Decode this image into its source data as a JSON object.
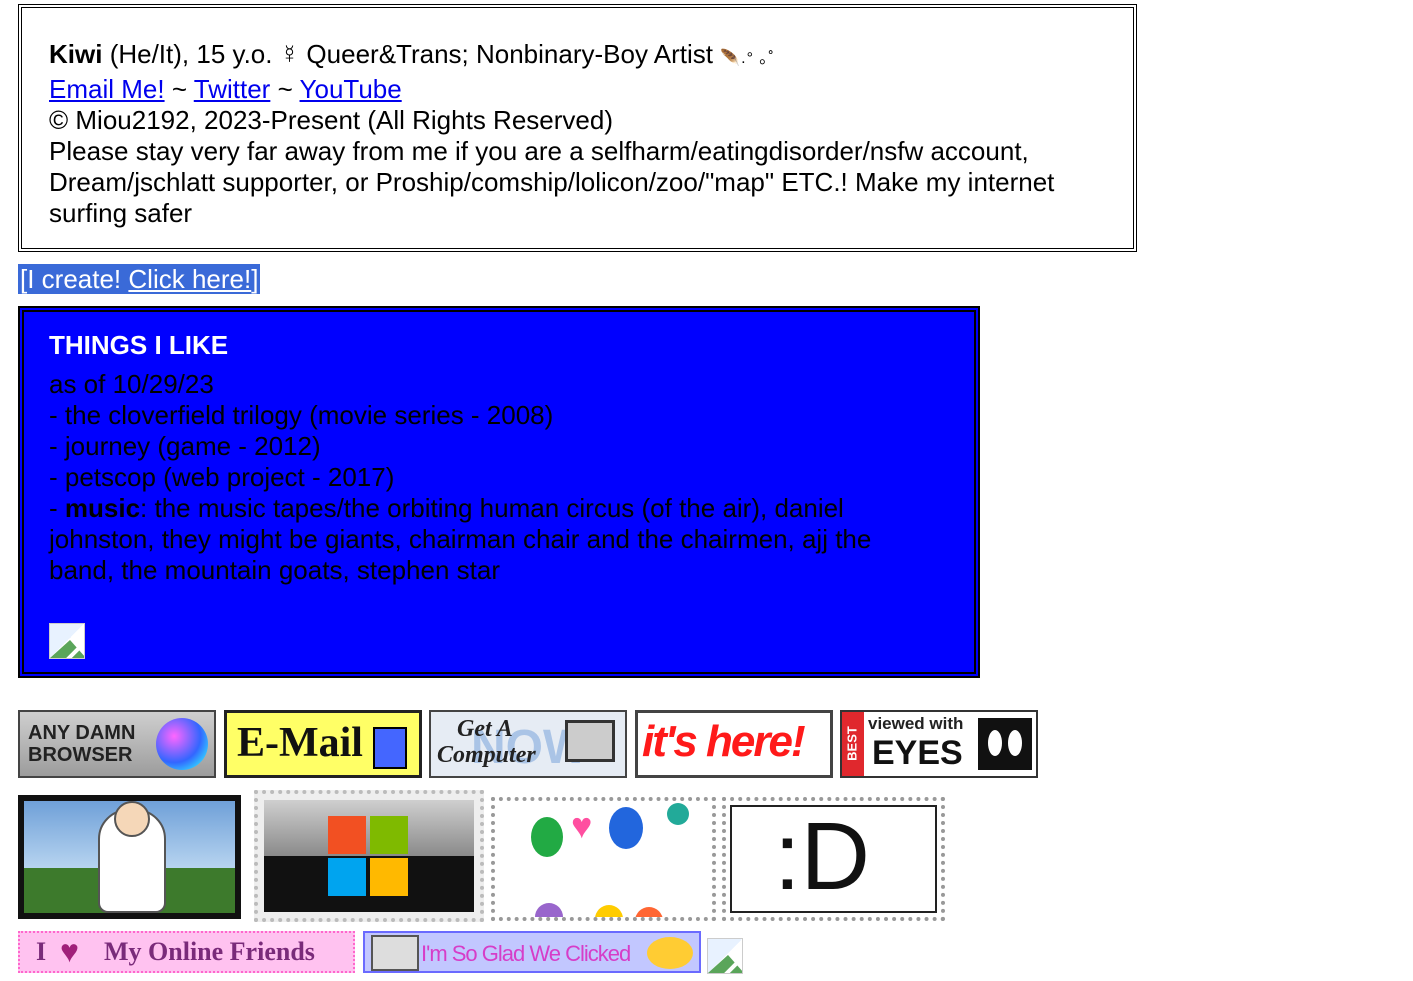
{
  "profile": {
    "name": "Kiwi",
    "pronouns_age": "(He/It), 15 y.o. ☿ Queer&Trans; Nonbinary-Boy Artist",
    "sparkle": "🪶.° ｡˚",
    "links": {
      "email": "Email Me!",
      "sep1": "~",
      "twitter": "Twitter",
      "sep2": "~",
      "youtube": "YouTube"
    },
    "copyright": "© Miou2192, 2023-Present (All Rights Reserved)",
    "warning": "Please stay very far away from me if you are a selfharm/eatingdisorder/nsfw account, Dream/jschlatt supporter, or Proship/comship/lolicon/zoo/\"map\" ETC.! Make my internet surfing safer"
  },
  "create_link": {
    "prefix": "[I create! ",
    "link": "Click here!",
    "suffix": "]"
  },
  "likes": {
    "title": "THINGS I LIKE",
    "as_of": "as of 10/29/23",
    "items": [
      "- the cloverfield trilogy (movie series - 2008)",
      "- journey (game - 2012)",
      "- petscop (web project - 2017)"
    ],
    "music_prefix": "- ",
    "music_label": "music",
    "music_list": ": the music tapes/the orbiting human circus (of the air), daniel johnston, they might be giants, chairman chair and the chairmen, ajj the band, the mountain goats, stephen star"
  },
  "buttons": [
    {
      "line1": "ANY DAMN",
      "line2": "BROWSER"
    },
    {
      "text": "E-Mail"
    },
    {
      "line1": "Get A",
      "line2": "Computer",
      "bg_word": "NOW"
    },
    {
      "text": "it's here!"
    },
    {
      "side": "BEST",
      "top": "viewed with",
      "main": "EYES"
    }
  ],
  "stamps": [
    {
      "alt": "cartoon man stamp"
    },
    {
      "alt": "windows logo stamp"
    },
    {
      "alt": "balloons stamp"
    },
    {
      "text": ":D"
    }
  ],
  "blinkies": [
    {
      "prefix": "I",
      "text": "My Online Friends"
    },
    {
      "text": "I'm So Glad We Clicked"
    }
  ],
  "colors": {
    "likes_bg": "#0000ff",
    "create_bg": "#3a6ad8",
    "link": "#0000ee"
  }
}
